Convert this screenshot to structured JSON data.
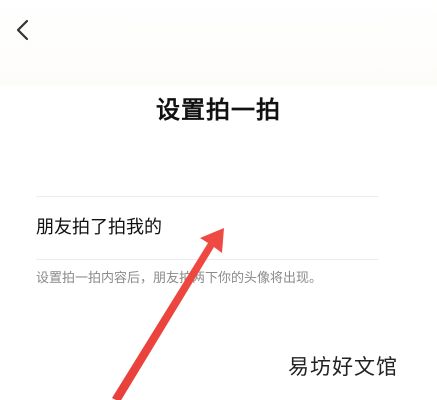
{
  "header": {
    "back_icon": "chevron-left-icon"
  },
  "page": {
    "title": "设置拍一拍"
  },
  "form": {
    "pat_text_value": "朋友拍了拍我的",
    "hint": "设置拍一拍内容后，朋友拍两下你的头像将出现。"
  },
  "annotation": {
    "arrow_color": "#e8403a"
  },
  "watermark": {
    "text": "易坊好文馆"
  }
}
